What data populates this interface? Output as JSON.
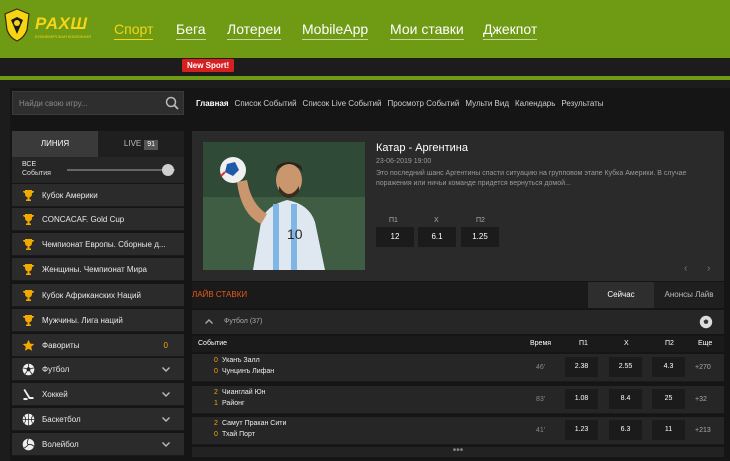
{
  "brand": {
    "name": "РАХШ",
    "tagline": "БУКМЕКЕРСКАЯ КОМПАНИЯ"
  },
  "nav": {
    "items": [
      "Спорт",
      "Бега",
      "Лотереи",
      "MobileApp",
      "Мои ставки",
      "Джекпот"
    ],
    "badge": "New Sport!"
  },
  "search": {
    "placeholder": "Найди свою игру..."
  },
  "subnav": [
    "Главная",
    "Список Событий",
    "Список Live Событий",
    "Просмотр Событий",
    "Мульти Вид",
    "Календарь",
    "Результаты"
  ],
  "sidebar": {
    "tabs": {
      "line": "ЛИНИЯ",
      "live": "LIVE",
      "live_count": "91"
    },
    "all_label_1": "ВСЕ",
    "all_label_2": "События",
    "leagues": [
      "Кубок Америки",
      "CONCACAF. Gold Cup",
      "Чемпионат Европы. Сборные д...",
      "Женщины. Чемпионат Мира",
      "Кубок Африканских Наций",
      "Мужчины. Лига наций"
    ],
    "favorites": {
      "label": "Фавориты",
      "count": "0"
    },
    "sports": [
      "Футбол",
      "Хоккей",
      "Баскетбол",
      "Волейбол"
    ]
  },
  "featured": {
    "title": "Катар - Аргентина",
    "date": "23-06-2019 19:00",
    "description": "Это последний шанс Аргентины спасти ситуацию на групповом этапе Кубка Америки. В случае поражения или ничьи команде придется вернуться домой...",
    "odds_labels": [
      "П1",
      "Х",
      "П2"
    ],
    "odds": [
      "12",
      "6.1",
      "1.25"
    ]
  },
  "live": {
    "title": "ЛАЙВ СТАВКИ",
    "tab_now": "Сейчас",
    "tab_announce": "Анонсы Лайв",
    "sport": "Футбол",
    "sport_count": "(37)",
    "columns": {
      "event": "Событие",
      "time": "Время",
      "p1": "П1",
      "x": "Х",
      "p2": "П2",
      "more": "Еще"
    },
    "matches": [
      {
        "s1": "0",
        "t1": "Уканъ Залл",
        "s2": "0",
        "t2": "Чунцинъ Лифан",
        "time": "46'",
        "p1": "2.38",
        "x": "2.55",
        "p2": "4.3",
        "more": "+270"
      },
      {
        "s1": "2",
        "t1": "Чианглай Юн",
        "s2": "1",
        "t2": "Районг",
        "time": "83'",
        "p1": "1.08",
        "x": "8.4",
        "p2": "25",
        "more": "+32"
      },
      {
        "s1": "2",
        "t1": "Самут Пракан Сити",
        "s2": "0",
        "t2": "Тхай Порт",
        "time": "41'",
        "p1": "1.23",
        "x": "6.3",
        "p2": "11",
        "more": "+213"
      }
    ],
    "more_dots": "•••"
  },
  "colors": {
    "brand_green": "#6f9a14",
    "accent_yellow": "#f7d515",
    "live_orange": "#e85a1c",
    "badge_red": "#d61f1f"
  }
}
